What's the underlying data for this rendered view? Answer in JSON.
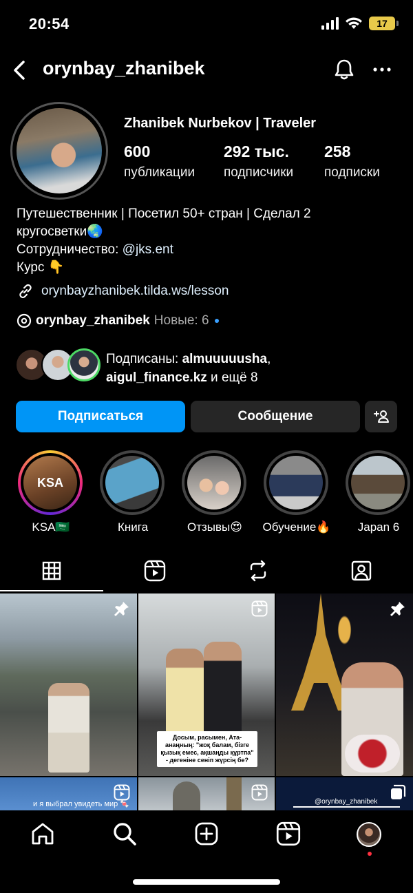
{
  "status_bar": {
    "time": "20:54",
    "battery": "17"
  },
  "header": {
    "username": "orynbay_zhanibek"
  },
  "profile": {
    "full_name": "Zhanibek Nurbekov | Traveler",
    "stats": [
      {
        "value": "600",
        "label": "публикации"
      },
      {
        "value": "292 тыс.",
        "label": "подписчики"
      },
      {
        "value": "258",
        "label": "подписки"
      }
    ],
    "bio_line1": "Путешественник | Посетил 50+ стран | Сделал 2",
    "bio_line2": "кругосветки🌏",
    "bio_line3_prefix": "Сотрудничество: ",
    "bio_line3_mention": "@jks.ent",
    "bio_line4": "Курс 👇",
    "link": "orynbayzhanibek.tilda.ws/lesson",
    "threads_handle": "orynbay_zhanibek",
    "threads_new": "Новые: 6"
  },
  "followed_by": {
    "prefix": "Подписаны: ",
    "user1": "almuuuuusha",
    "comma": ",",
    "user2": "aigul_finance.kz",
    "suffix": " и ещё 8"
  },
  "actions": {
    "follow": "Подписаться",
    "message": "Сообщение"
  },
  "highlights": [
    {
      "title": "KSA🇸🇦",
      "cover_text": "KSA"
    },
    {
      "title": "Книга"
    },
    {
      "title": "Отзывы😍"
    },
    {
      "title": "Обучение🔥"
    },
    {
      "title": "Japan 6"
    }
  ],
  "posts": {
    "caption_2": "Досым, расымен, Ата-анаңның: \"жоқ балам, бізге қызық емес, ақшаңды құртпа\" - дегеніне сеніп жүрсің бе?",
    "caption_4": "и я выбрал увидеть мир 🍬",
    "caption_6": "@orynbay_zhanibek"
  },
  "colors": {
    "primary_button": "#0095f6",
    "secondary_button": "#262626",
    "background": "#000000"
  }
}
